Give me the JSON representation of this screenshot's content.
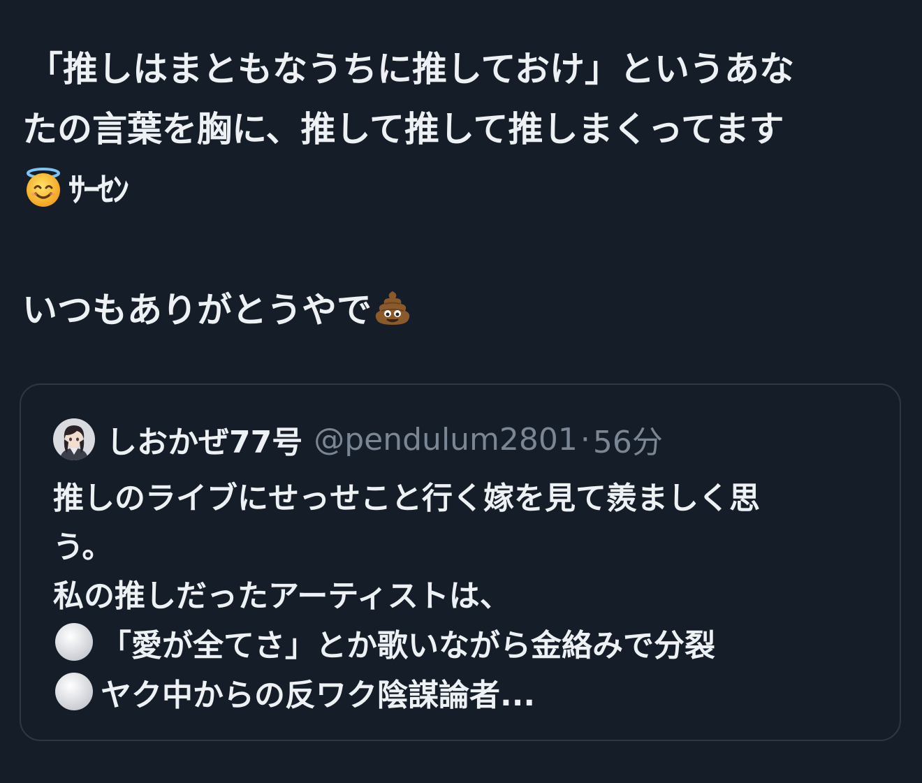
{
  "post": {
    "line1": "「推しはまともなうちに推しておけ」というあな",
    "line2": "たの言葉を胸に、推して推して推しまくってます",
    "line3_emoji": "smiling-face-with-halo",
    "line3_text": "ｻｰｾﾝ",
    "line4_text": "いつもありがとうやで",
    "line4_emoji": "pile-of-poo"
  },
  "quote": {
    "avatar_icon": "avatar",
    "author_name": "しおかぜ77号",
    "author_handle": "@pendulum2801",
    "separator": "·",
    "time": "56分",
    "lines": [
      "推しのライブにせっせこと行く嫁を見て羨ましく思",
      "う。",
      "私の推しだったアーティストは、",
      "「愛が全てさ」とか歌いながら金絡みで分裂",
      "ヤク中からの反ワク陰謀論者..."
    ],
    "bullet_icon": "white-circle"
  }
}
